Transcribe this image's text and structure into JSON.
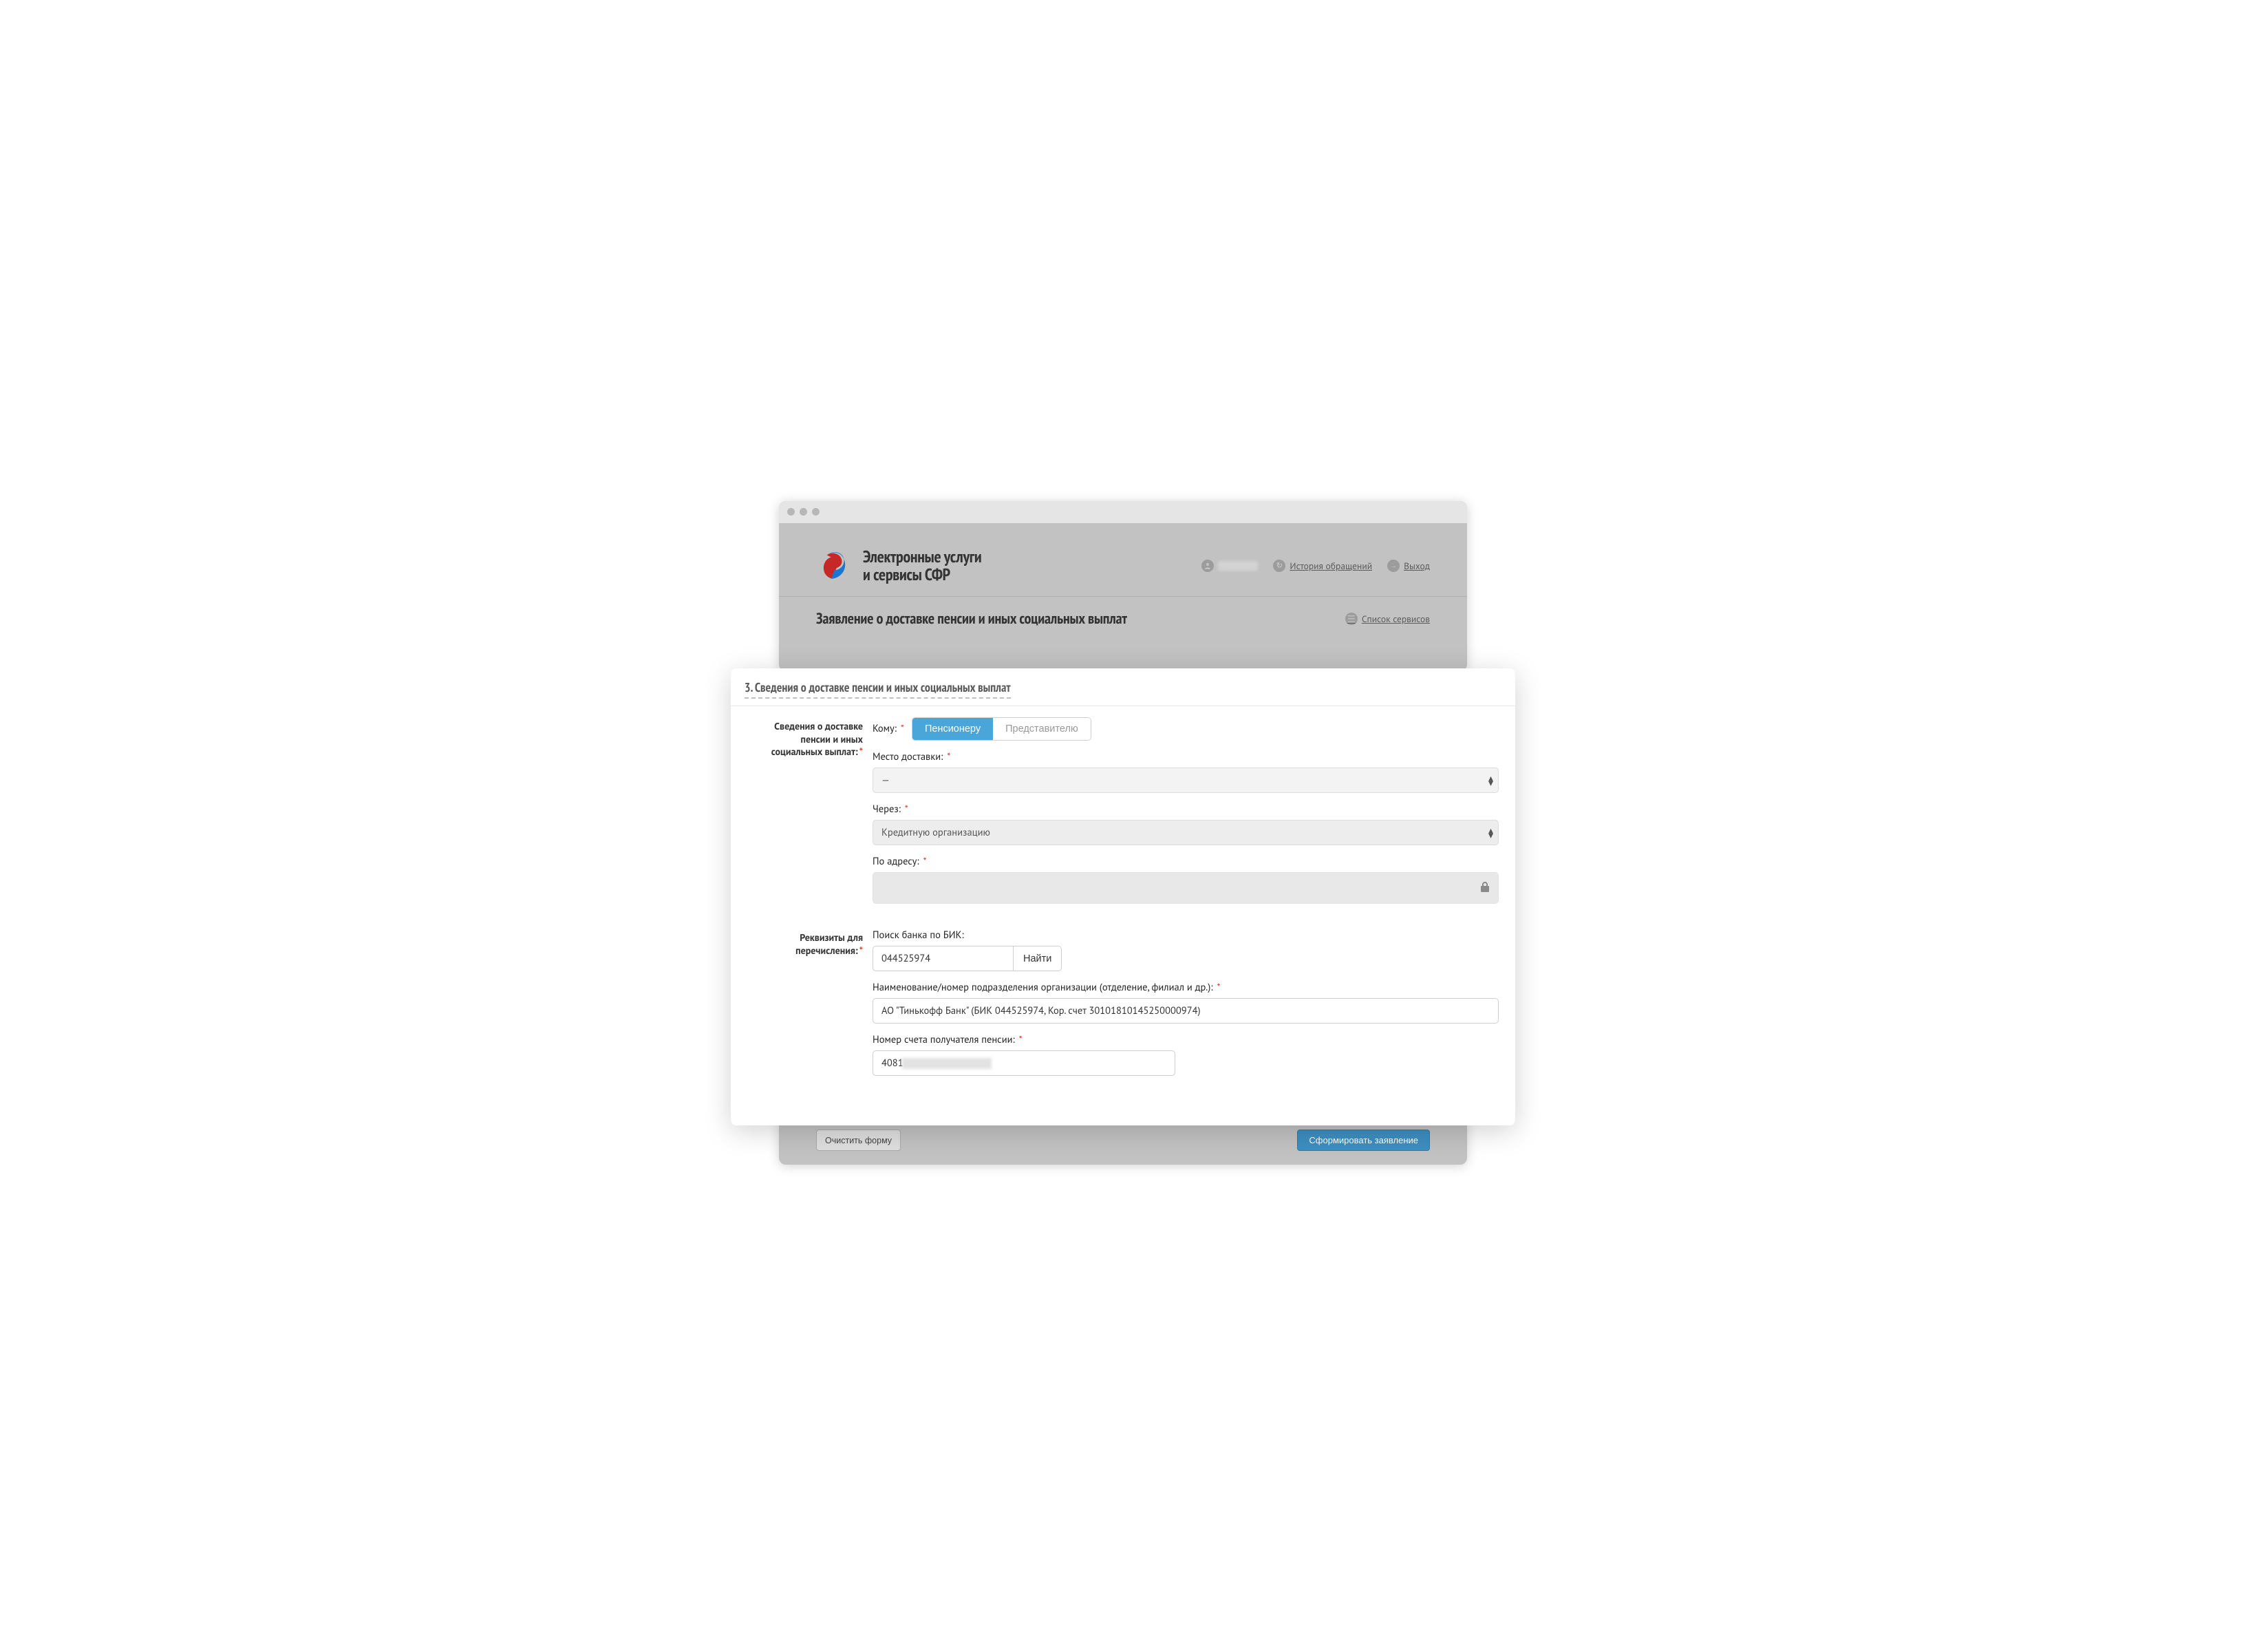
{
  "brand": {
    "title_line1": "Электронные услуги",
    "title_line2": "и сервисы СФР"
  },
  "header_links": {
    "history": "История обращений",
    "logout": "Выход"
  },
  "page_title": "Заявление о доставке пенсии и иных социальных выплат",
  "services_list": "Список сервисов",
  "section": {
    "number": "3.",
    "title": "Сведения о доставке пенсии и иных социальных выплат"
  },
  "group1": {
    "label": "Сведения о доставке пенсии и иных социальных выплат:",
    "whom_label": "Кому:",
    "whom_options": {
      "pensioner": "Пенсионеру",
      "representative": "Представителю"
    },
    "place_label": "Место доставки:",
    "place_value": "—",
    "via_label": "Через:",
    "via_value": "Кредитную организацию",
    "address_label": "По адресу:"
  },
  "group2": {
    "label": "Реквизиты для перечисления:",
    "bik_label": "Поиск банка по БИК:",
    "bik_value": "044525974",
    "find_btn": "Найти",
    "org_label": "Наименование/номер подразделения организации (отделение, филиал и др.):",
    "org_value": "АО \"Тинькофф Банк\" (БИК 044525974, Кор. счет 30101810145250000974)",
    "acct_label": "Номер счета получателя пенсии:",
    "acct_prefix": "4081"
  },
  "footer": {
    "clear": "Очистить форму",
    "submit": "Сформировать заявление"
  }
}
